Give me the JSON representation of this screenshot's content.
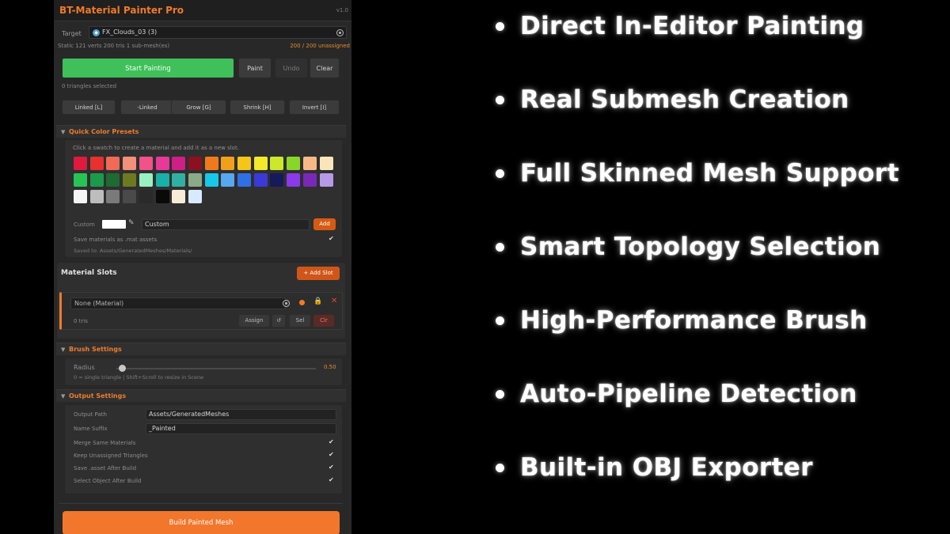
{
  "panel": {
    "title": "BT-Material Painter Pro",
    "version": "v1.0",
    "target_label": "Target",
    "target_value": "FX_Clouds_03 (3)",
    "mesh_info": "Static  121 verts  200 tris  1 sub-mesh(es)",
    "unassigned": "200 / 200 unassigned",
    "start_painting": "Start Painting",
    "paint": "Paint",
    "undo": "Undo",
    "clear": "Clear",
    "triangles_selected": "0 triangles selected",
    "selection_buttons": [
      "Linked [L]",
      "-Linked",
      "Grow [G]",
      "Shrink [H]",
      "Invert [I]"
    ]
  },
  "presets": {
    "header": "Quick Color Presets",
    "hint": "Click a swatch to create a material and add it as a new slot.",
    "swatches": [
      [
        "#e0193e",
        "#e8302e",
        "#f06a55",
        "#f2907a",
        "#f2518a",
        "#e8389a",
        "#cf1f86",
        "#8c1020",
        "#f07a1a",
        "#f2a019",
        "#f5c518",
        "#f2ea2a",
        "#cce82a",
        "#8ad628",
        "#f7b888",
        "#f8e6b8"
      ],
      [
        "#27c455",
        "#1a9a4a",
        "#1e6a32",
        "#6e7a20",
        "#99f0c0",
        "#18b0a8",
        "#30b0a0",
        "#8aaa88",
        "#18c8e8",
        "#58a8f0",
        "#2f70e8",
        "#3a3ad8",
        "#151a5a",
        "#8a3ae8",
        "#7a28b8",
        "#b69ae8"
      ],
      [
        "#f5f5f5",
        "#bdbdbd",
        "#7a7a7a",
        "#4a4a4a",
        "#2a2a2a",
        "#0a0a0a",
        "#f8ecd8",
        "#d8eaff"
      ]
    ],
    "custom_label": "Custom",
    "custom_name": "Custom",
    "add": "Add",
    "save_materials": "Save materials as .mat assets",
    "saved_to": "Saved to: Assets/GeneratedMeshes/Materials/"
  },
  "slots": {
    "title": "Material Slots",
    "add_slot": "+ Add Slot",
    "slot_material": "None (Material)",
    "slot_tris": "0 tris",
    "assign": "Assign",
    "reset": "↺",
    "sel": "Sel",
    "clr": "Clr"
  },
  "brush": {
    "header": "Brush Settings",
    "radius_label": "Radius",
    "radius_value": "0.50",
    "radius_fraction": 0.03,
    "hint": "0 = single triangle | Shift+Scroll to resize in Scene"
  },
  "output": {
    "header": "Output Settings",
    "output_path_label": "Output Path",
    "output_path": "Assets/GeneratedMeshes",
    "name_suffix_label": "Name Suffix",
    "name_suffix": "_Painted",
    "options": [
      "Merge Same Materials",
      "Keep Unassigned Triangles",
      "Save .asset After Build",
      "Select Object After Build"
    ]
  },
  "build": "Build Painted Mesh",
  "features": [
    "Direct In-Editor Painting",
    "Real Submesh Creation",
    "Full Skinned Mesh Support",
    "Smart Topology Selection",
    "High-Performance Brush",
    "Auto-Pipeline Detection",
    "Built-in OBJ Exporter"
  ]
}
